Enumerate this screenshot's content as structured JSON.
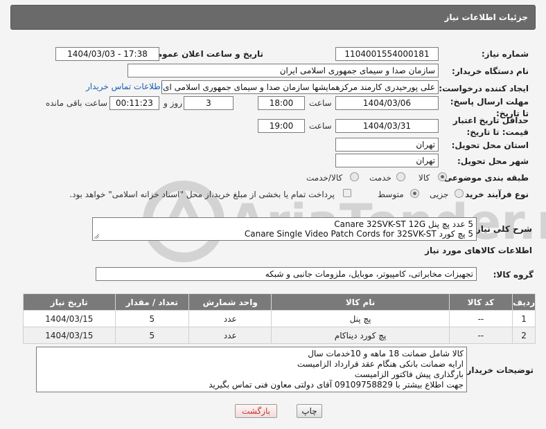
{
  "header": {
    "title": "جزئیات اطلاعات نیاز"
  },
  "fields": {
    "need_number_label": "شماره نیاز:",
    "need_number": "1104001554000181",
    "announce_label": "تاریخ و ساعت اعلان عمومی:",
    "announce_value": "1404/03/03 - 17:38",
    "buyer_org_label": "نام دستگاه خریدار:",
    "buyer_org": "سازمان صدا و سیمای جمهوری اسلامی ایران",
    "creator_label": "ایجاد کننده درخواست:",
    "creator": "علی پورحیدری کارمند مرکزهمایشها سازمان صدا و سیمای جمهوری اسلامی ای",
    "buyer_contact_link": "اطلاعات تماس خریدار",
    "deadline_label": "مهلت ارسال پاسخ: تا تاریخ:",
    "deadline_date": "1404/03/06",
    "time_label": "ساعت",
    "deadline_time": "18:00",
    "days_count": "3",
    "days_label": "روز و",
    "remaining_time": "00:11:23",
    "remaining_label": "ساعت باقی مانده",
    "validity_label": "حداقل تاریخ اعتبار قیمت: تا تاریخ:",
    "validity_date": "1404/03/31",
    "validity_time_label": "ساعت",
    "validity_time": "19:00",
    "province_label": "استان محل تحویل:",
    "province": "تهران",
    "city_label": "شهر محل تحویل:",
    "city": "تهران",
    "category_label": "طبقه بندی موضوعی:",
    "category_options": [
      "کالا",
      "خدمت",
      "کالا/خدمت"
    ],
    "process_label": "نوع فرآیند خرید :",
    "process_options": [
      "جزیی",
      "متوسط"
    ],
    "payment_note": "پرداخت تمام یا بخشی از مبلغ خرید،از محل \"اسناد خزانه اسلامی\" خواهد بود."
  },
  "summary": {
    "label": "شرح کلی نیاز:",
    "line1": "5 عدد پچ پنل Canare  32SVK-ST 12G",
    "line2": "5 پچ کورد  Canare Single Video Patch Cords for 32SVK-ST"
  },
  "goods": {
    "section_title": "اطلاعات کالاهای مورد نیاز",
    "group_label": "گروه کالا:",
    "group_value": "تجهیزات مخابراتی، کامپیوتر، موبایل، ملزومات جانبی و شبکه",
    "columns": [
      "ردیف",
      "کد کالا",
      "نام کالا",
      "واحد شمارش",
      "تعداد / مقدار",
      "تاریخ نیاز"
    ],
    "rows": [
      [
        "1",
        "--",
        "پچ پنل",
        "عدد",
        "5",
        "1404/03/15"
      ],
      [
        "2",
        "--",
        "پچ کورد دیناکام",
        "عدد",
        "5",
        "1404/03/15"
      ]
    ]
  },
  "notes": {
    "label": "توضیحات خریدار:",
    "lines": [
      "کالا شامل ضمانت 18 ماهه و 10خدمات سال",
      "ارایه ضمانت بانکی هنگام عقد قرارداد الزامیست",
      "بارگذاری پیش فاکتور الزامیست",
      "جهت اطلاع بیشتر با 09109758829 آقای دولتی معاون فنی تماس بگیرید"
    ]
  },
  "buttons": {
    "print": "چاپ",
    "back": "بازگشت"
  },
  "watermark": {
    "text": "AriaTender.neT"
  },
  "colors": {
    "header_bg": "#6a6a6a",
    "link": "#1a5fb4",
    "table_head": "#7a7a7a",
    "back_text": "#c0392b"
  }
}
